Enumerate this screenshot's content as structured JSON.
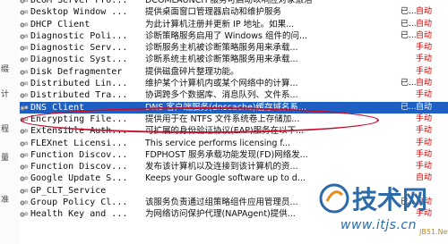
{
  "left_pane": {
    "glyphs": [
      "缀",
      "计",
      "程",
      "量",
      "准"
    ]
  },
  "services": [
    {
      "name": "DCOM Server Pro...",
      "description": "DCOMLAUNCH 服务可启动以响应对象激活",
      "status": "",
      "startup": ""
    },
    {
      "name": "Desktop Window ...",
      "description": "提供桌面窗口管理器启动和维护服务",
      "status": "已...",
      "startup": "自动"
    },
    {
      "name": "DHCP Client",
      "description": "为此计算机注册并更新 IP 地址。如果...",
      "status": "已...",
      "startup": "自动"
    },
    {
      "name": "Diagnostic Poli...",
      "description": "诊断策略服务启用了 Windows 组件的问...",
      "status": "已...",
      "startup": "自动"
    },
    {
      "name": "Diagnostic Serv...",
      "description": "诊断服务主机被诊断策略服务用来承载...",
      "status": "",
      "startup": "手动"
    },
    {
      "name": "Diagnostic Syst...",
      "description": "诊断系统主机被诊断策略服务用来承载...",
      "status": "",
      "startup": "手动"
    },
    {
      "name": "Disk Defragmenter",
      "description": "提供磁盘碎片整理功能。",
      "status": "",
      "startup": "手动"
    },
    {
      "name": "Distributed Lin...",
      "description": "维护某个计算机内或某个网络中的计算...",
      "status": "已...",
      "startup": "自动"
    },
    {
      "name": "Distributed Tra...",
      "description": "协调跨多个数据库、消息队列、文件系...",
      "status": "",
      "startup": "手动"
    },
    {
      "name": "DNS Client",
      "description": "DNS 客户端服务(dnscache)缓存域名系...",
      "status": "已...",
      "startup": "自动"
    },
    {
      "name": "Encrypting File...",
      "description": "提供用于在 NTFS 文件系统卷上存储加...",
      "status": "",
      "startup": "手动"
    },
    {
      "name": "Extensible Auth...",
      "description": "可扩展的身份验证协议(EAP)服务在以下...",
      "status": "",
      "startup": "手动"
    },
    {
      "name": "FLEXnet Licensi...",
      "description": "This service performs licensing f...",
      "status": "",
      "startup": "手动"
    },
    {
      "name": "Function Discov...",
      "description": "FDPHOST 服务承载功能发现(FD)网络发...",
      "status": "",
      "startup": "手动"
    },
    {
      "name": "Function Discov...",
      "description": "发布该计算机以及连接到该计算机的资...",
      "status": "",
      "startup": "手动"
    },
    {
      "name": "Google Update S...",
      "description": "Keeps your Google software up to d...",
      "status": "",
      "startup": "自动"
    },
    {
      "name": "GP_CLT_Service",
      "description": "",
      "status": "",
      "startup": ""
    },
    {
      "name": "Group Policy Cl...",
      "description": "该服务负责通过组策略组件应用管理员...",
      "status": "已...",
      "startup": "自动"
    },
    {
      "name": "Health Key and ...",
      "description": "为网络访问保护代理(NAPAgent)提供...",
      "status": "",
      "startup": "手动"
    }
  ],
  "selected_row": 9,
  "watermark": {
    "logo_text": "技术网",
    "url": "www.itjs.cn",
    "small_text": "JB51.Net"
  },
  "colors": {
    "selection": "#1d5fc2",
    "annotation": "#c8102e",
    "watermark_blue": "#2c6aa8",
    "watermark_orange": "#e58a1b"
  }
}
